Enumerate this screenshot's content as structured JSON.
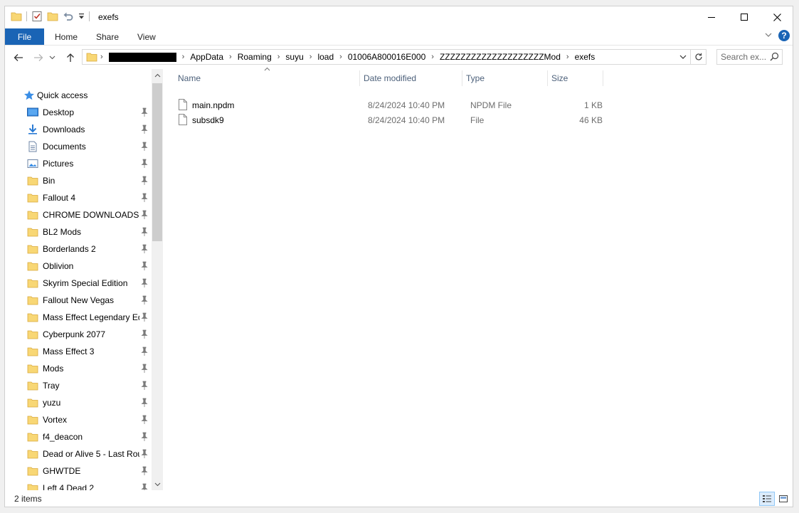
{
  "window": {
    "title": "exefs"
  },
  "ribbon": {
    "tabs": [
      "File",
      "Home",
      "Share",
      "View"
    ],
    "help_label": "?"
  },
  "address": {
    "crumbs": [
      "AppData",
      "Roaming",
      "suyu",
      "load",
      "01006A800016E000",
      "ZZZZZZZZZZZZZZZZZZZZMod",
      "exefs"
    ]
  },
  "search": {
    "placeholder": "Search ex..."
  },
  "nav": {
    "quick_access": "Quick access",
    "items": [
      {
        "label": "Desktop",
        "icon": "desktop-icon"
      },
      {
        "label": "Downloads",
        "icon": "downloads-icon"
      },
      {
        "label": "Documents",
        "icon": "documents-icon"
      },
      {
        "label": "Pictures",
        "icon": "pictures-icon"
      },
      {
        "label": "Bin",
        "icon": "folder-icon"
      },
      {
        "label": "Fallout 4",
        "icon": "folder-icon"
      },
      {
        "label": "CHROME DOWNLOADS",
        "icon": "folder-icon"
      },
      {
        "label": "BL2 Mods",
        "icon": "folder-icon"
      },
      {
        "label": "Borderlands 2",
        "icon": "folder-icon"
      },
      {
        "label": "Oblivion",
        "icon": "folder-icon"
      },
      {
        "label": "Skyrim Special Edition",
        "icon": "folder-icon"
      },
      {
        "label": "Fallout New Vegas",
        "icon": "folder-icon"
      },
      {
        "label": "Mass Effect Legendary Edi",
        "icon": "folder-icon"
      },
      {
        "label": "Cyberpunk 2077",
        "icon": "folder-icon"
      },
      {
        "label": "Mass Effect 3",
        "icon": "folder-icon"
      },
      {
        "label": "Mods",
        "icon": "folder-icon"
      },
      {
        "label": "Tray",
        "icon": "folder-icon"
      },
      {
        "label": "yuzu",
        "icon": "folder-icon"
      },
      {
        "label": "Vortex",
        "icon": "folder-icon"
      },
      {
        "label": "f4_deacon",
        "icon": "folder-icon"
      },
      {
        "label": "Dead or Alive 5 - Last Rou",
        "icon": "folder-icon"
      },
      {
        "label": "GHWTDE",
        "icon": "folder-icon"
      },
      {
        "label": "Left 4 Dead 2",
        "icon": "folder-icon"
      }
    ]
  },
  "files": {
    "columns": [
      "Name",
      "Date modified",
      "Type",
      "Size"
    ],
    "rows": [
      {
        "name": "main.npdm",
        "date": "8/24/2024 10:40 PM",
        "type": "NPDM File",
        "size": "1 KB"
      },
      {
        "name": "subsdk9",
        "date": "8/24/2024 10:40 PM",
        "type": "File",
        "size": "46 KB"
      }
    ]
  },
  "status": {
    "count": "2 items"
  },
  "colors": {
    "accent": "#1a64b5",
    "folder": "#f8d775",
    "header_text": "#4c607a"
  }
}
